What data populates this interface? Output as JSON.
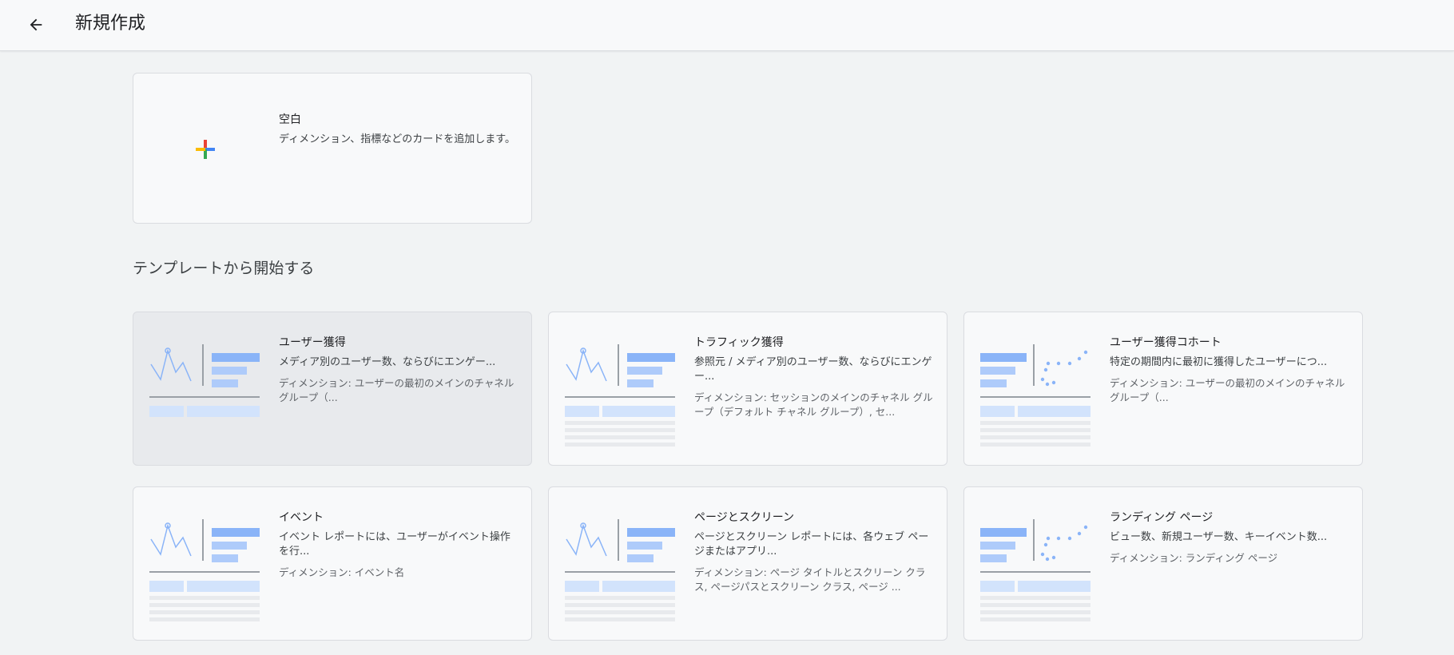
{
  "header": {
    "title": "新規作成"
  },
  "blank": {
    "title": "空白",
    "desc": "ディメンション、指標などのカードを追加します。"
  },
  "section": {
    "heading": "テンプレートから開始する"
  },
  "templates": [
    {
      "title": "ユーザー獲得",
      "desc": "メディア別のユーザー数、ならびにエンゲー...",
      "dim": "ディメンション: ユーザーの最初のメインのチャネル グループ（..."
    },
    {
      "title": "トラフィック獲得",
      "desc": "参照元 / メディア別のユーザー数、ならびにエンゲー...",
      "dim": "ディメンション: セッションのメインのチャネル グループ（デフォルト チャネル グループ）, セ..."
    },
    {
      "title": "ユーザー獲得コホート",
      "desc": "特定の期間内に最初に獲得したユーザーにつ...",
      "dim": "ディメンション: ユーザーの最初のメインのチャネル グループ（..."
    },
    {
      "title": "イベント",
      "desc": "イベント レポートには、ユーザーがイベント操作を行...",
      "dim": "ディメンション: イベント名"
    },
    {
      "title": "ページとスクリーン",
      "desc": "ページとスクリーン レポートには、各ウェブ ページまたはアプリ...",
      "dim": "ディメンション: ページ タイトルとスクリーン クラス, ページパスとスクリーン クラス, ページ ..."
    },
    {
      "title": "ランディング ページ",
      "desc": "ビュー数、新規ユーザー数、キーイベント数...",
      "dim": "ディメンション: ランディング ページ"
    }
  ],
  "icons": {
    "back": "arrow-back-icon",
    "plus": "colorful-plus-icon",
    "thumb_line": "line-chart-thumbnail",
    "thumb_scatter": "scatter-chart-thumbnail"
  },
  "colors": {
    "accent_blue": "#8ab4f8",
    "light_blue": "#aecbfa",
    "hover_card": "#e8eaed"
  }
}
